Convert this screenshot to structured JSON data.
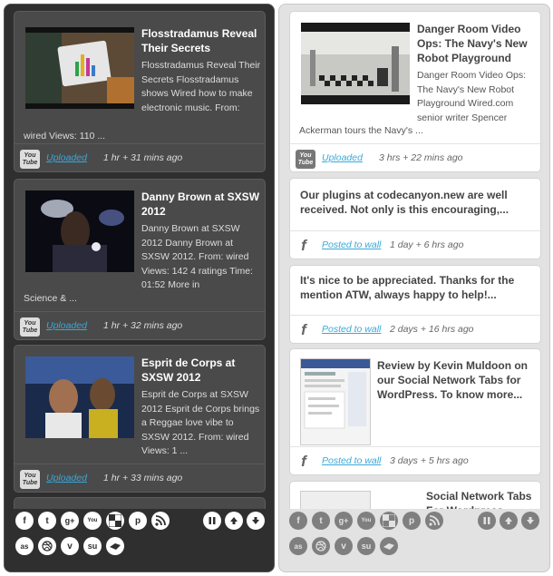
{
  "left": {
    "posts": [
      {
        "title": "Flosstradamus Reveal Their Secrets",
        "desc_top": "Flosstradamus Reveal Their Secrets Flosstradamus shows Wired how to make electronic music. From:",
        "desc_bottom": "wired Views: 110 ...",
        "link": "Uploaded",
        "time": "1 hr + 31 mins ago"
      },
      {
        "title": "Danny Brown at SXSW 2012",
        "desc_top": "Danny Brown at SXSW 2012 Danny Brown at SXSW 2012. From: wired Views: 142 4 ratings Time: 01:52 More in",
        "desc_bottom": "Science & ...",
        "link": "Uploaded",
        "time": "1 hr + 32 mins ago"
      },
      {
        "title": "Esprit de Corps at SXSW 2012",
        "desc_top": "Esprit de Corps at SXSW 2012 Esprit de Corps brings a Reggae love vibe to SXSW 2012. From: wired Views: 1 ...",
        "desc_bottom": "",
        "link": "Uploaded",
        "time": "1 hr + 33 mins ago"
      }
    ]
  },
  "right": {
    "posts": [
      {
        "title": "Danger Room Video Ops: The Navy's New Robot Playground",
        "desc_top": "Danger Room Video Ops: The Navy's New Robot Playground Wired.com senior writer Spencer",
        "desc_bottom": "Ackerman tours the Navy's ...",
        "link": "Uploaded",
        "time": "3 hrs + 22 mins ago"
      },
      {
        "title": "Our plugins at codecanyon.new are well received. Not only is this encouraging,...",
        "link": "Posted to wall",
        "time": "1 day + 6 hrs ago"
      },
      {
        "title": "It's nice to be appreciated. Thanks for the mention ATW, always happy to help!...",
        "link": "Posted to wall",
        "time": "2 days + 16 hrs ago"
      },
      {
        "title": "Review by Kevin Muldoon on our Social Network Tabs for WordPress. To know more...",
        "link": "Posted to wall",
        "time": "3 days + 5 hrs ago"
      },
      {
        "title": "Social Network Tabs For Wordpress"
      }
    ]
  },
  "badges": {
    "yt_top": "You",
    "yt_bottom": "Tube",
    "fb": "f"
  },
  "social_icons": [
    "facebook-icon",
    "twitter-icon",
    "google-plus-icon",
    "youtube-icon",
    "delicious-icon",
    "pinterest-icon",
    "rss-icon",
    "lastfm-icon",
    "dribbble-icon",
    "vimeo-icon",
    "stumbleupon-icon",
    "digg-icon"
  ],
  "colors": {
    "dark_bg": "#2f2f2f",
    "light_bg": "#e2e2e2",
    "link": "#3aa8d8"
  }
}
